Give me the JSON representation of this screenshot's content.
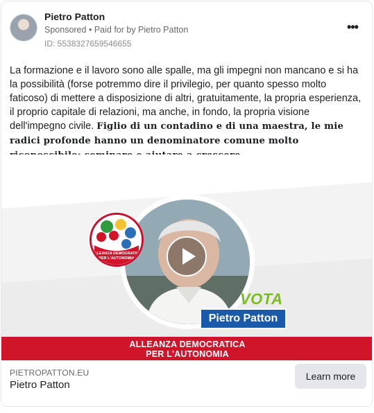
{
  "post": {
    "author": "Pietro Patton",
    "sponsored": "Sponsored",
    "separator": "•",
    "paid_for": "Paid for by Pietro Patton",
    "id_line": "ID: 5538327659546655",
    "more_icon": "more-horizontal-icon"
  },
  "body": {
    "paragraph": "La formazione e il lavoro sono alle spalle, ma gli impegni non mancano e si ha la possibilità (forse potremmo dire il privilegio, per quanto spesso molto faticoso) di mettere a disposizione di altri, gratuitamente, la propria esperienza, il proprio capitale di relazioni, ma anche, in fondo, la propria visione dell'impegno civile.",
    "bold_paragraph": "Figlio di un contadino e di una maestra, le mie radici profonde hanno un denominatore comune molto riconoscibile: seminare e aiutare a crescere",
    "bold_end": "."
  },
  "media": {
    "vota": "VOTA",
    "candidate": "Pietro Patton",
    "badge_text": "ALLEANZA DEMOCRATICA PER L'AUTONOMIA",
    "band_line1": "ALLEANZA DEMOCRATICA",
    "band_line2": "PER L'AUTONOMIA",
    "play_icon": "play-icon",
    "colors": {
      "band": "#d0152b",
      "vota": "#7bbd21",
      "name_box": "#1b5aa8"
    }
  },
  "footer": {
    "domain": "PIETROPATTON.EU",
    "title": "Pietro Patton",
    "cta": "Learn more"
  }
}
